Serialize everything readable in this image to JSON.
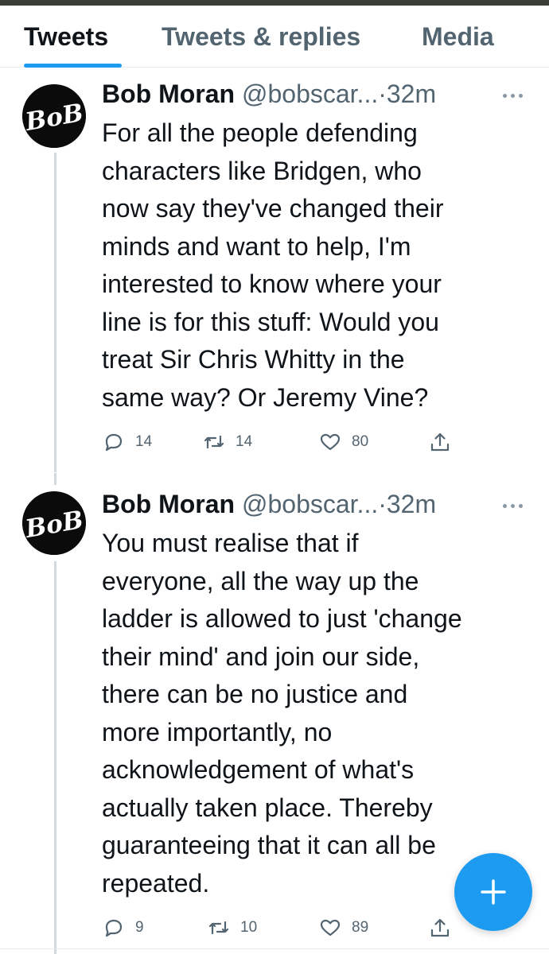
{
  "tabs": [
    {
      "label": "Tweets",
      "active": true
    },
    {
      "label": "Tweets & replies",
      "active": false
    },
    {
      "label": "Media",
      "active": false
    }
  ],
  "tweets": [
    {
      "avatar_text": "BoB",
      "name": "Bob Moran",
      "handle": "@bobscar...",
      "separator": "·",
      "time": "32m",
      "text": "For all the people defending\ncharacters like Bridgen, who\nnow say they've changed their\nminds and want to help, I'm\ninterested to know where your\nline is for this stuff: Would you\ntreat Sir Chris Whitty in the\nsame way? Or Jeremy Vine?",
      "replies": "14",
      "retweets": "14",
      "likes": "80"
    },
    {
      "avatar_text": "BoB",
      "name": "Bob Moran",
      "handle": "@bobscar...",
      "separator": "·",
      "time": "32m",
      "text": "You must realise that if\neveryone, all the way up the\nladder is allowed to just 'change\ntheir mind' and join our side,\nthere can be no justice and\nmore importantly, no\nacknowledgement of what's\nactually taken place. Thereby\nguaranteeing that it can all be\nrepeated.",
      "replies": "9",
      "retweets": "10",
      "likes": "89"
    }
  ],
  "icons": {
    "reply": "reply-icon",
    "retweet": "retweet-icon",
    "like": "heart-icon",
    "share": "share-icon",
    "more": "more-icon",
    "compose": "plus-icon"
  },
  "colors": {
    "accent": "#1d9bf0",
    "text": "#0f1419",
    "secondary": "#536471",
    "divider": "#e6ecf0",
    "thread": "#cfd9de"
  }
}
